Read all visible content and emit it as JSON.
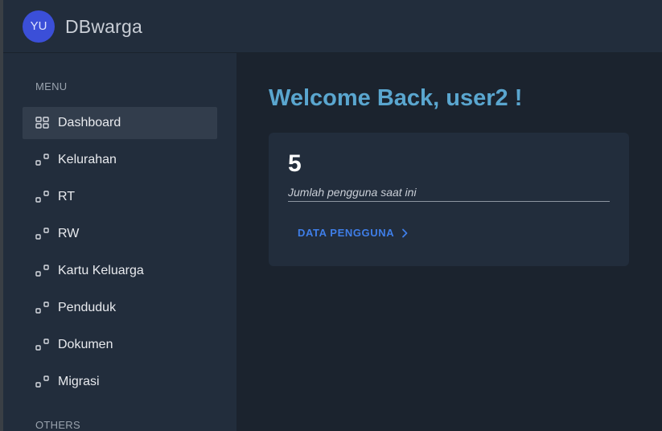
{
  "header": {
    "avatar_initials": "YU",
    "brand": "DBwarga"
  },
  "sidebar": {
    "section_menu": "MENU",
    "section_others": "OTHERS",
    "items": [
      {
        "label": "Dashboard",
        "icon": "grid-icon",
        "active": true
      },
      {
        "label": "Kelurahan",
        "icon": "nodes-icon"
      },
      {
        "label": "RT",
        "icon": "nodes-icon"
      },
      {
        "label": "RW",
        "icon": "nodes-icon"
      },
      {
        "label": "Kartu Keluarga",
        "icon": "nodes-icon"
      },
      {
        "label": "Penduduk",
        "icon": "nodes-icon"
      },
      {
        "label": "Dokumen",
        "icon": "nodes-icon"
      },
      {
        "label": "Migrasi",
        "icon": "nodes-icon"
      }
    ]
  },
  "main": {
    "welcome": "Welcome Back, user2 !",
    "card": {
      "count": "5",
      "count_label": "Jumlah pengguna saat ini",
      "link_label": "DATA PENGGUNA"
    }
  },
  "colors": {
    "accent_title": "#5aa6cf",
    "link": "#3f7ee8",
    "avatar": "#3b4fd8",
    "sidebar_bg": "#222d3c",
    "main_bg": "#1b232e"
  }
}
